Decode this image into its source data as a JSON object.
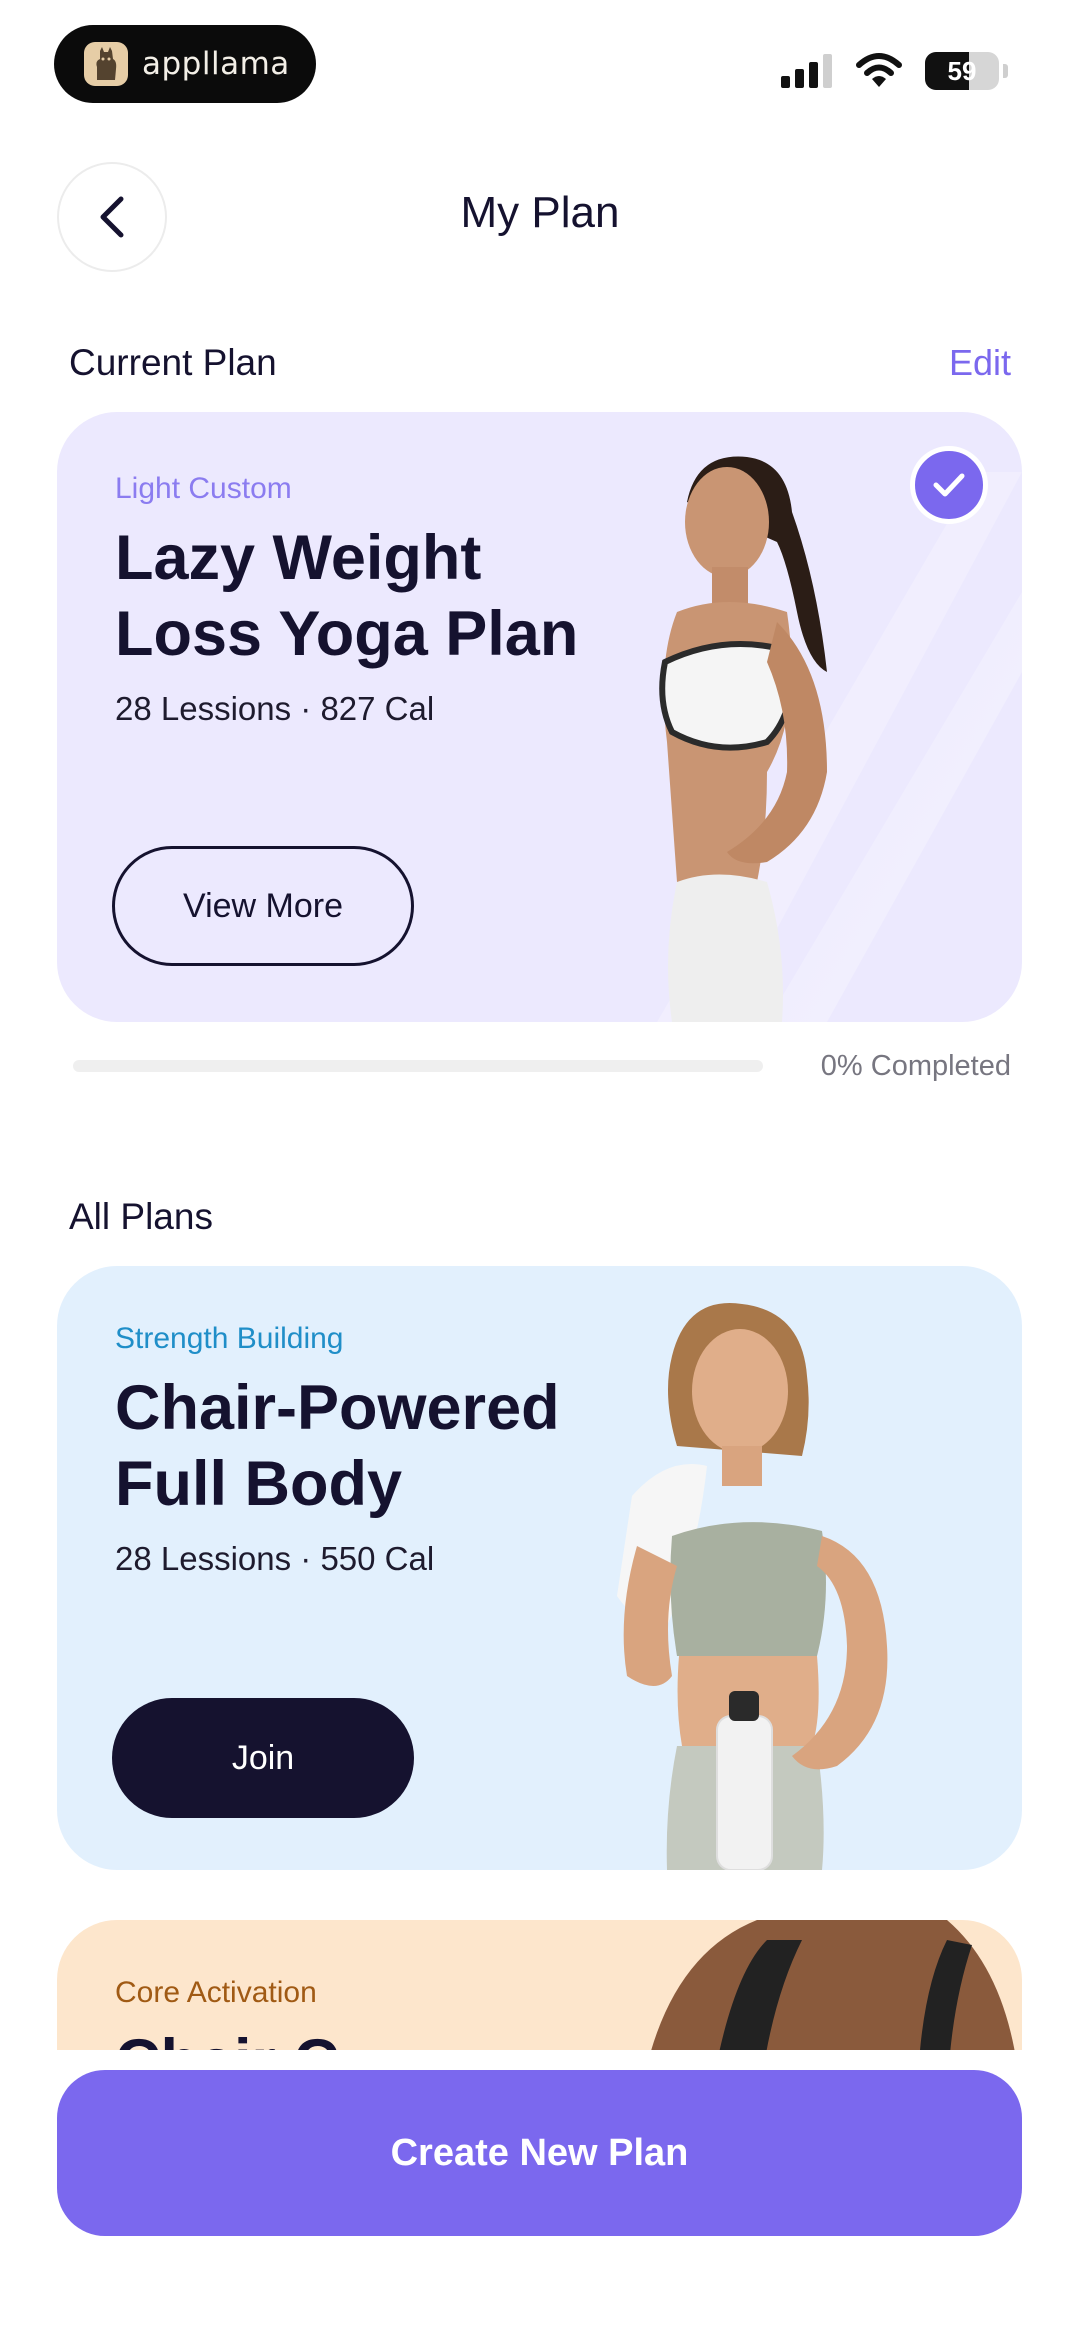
{
  "status_bar": {
    "brand": "appllama",
    "battery": "59",
    "battery_level_percent": 59
  },
  "header": {
    "title": "My Plan",
    "back_icon": "chevron-left-icon"
  },
  "current_plan": {
    "section_title": "Current Plan",
    "edit_label": "Edit",
    "card": {
      "category": "Light Custom",
      "title": "Lazy Weight Loss Yoga Plan",
      "meta": "28 Lessions · 827 Cal",
      "button_label": "View More",
      "selected_icon": "check-icon",
      "bg_color": "#ece9fe",
      "category_color": "#8b7cf0"
    },
    "progress_percent": 0,
    "progress_label": "0% Completed"
  },
  "all_plans": {
    "section_title": "All Plans",
    "cards": [
      {
        "category": "Strength Building",
        "title": "Chair-Powered Full Body",
        "meta": "28 Lessions · 550 Cal",
        "button_label": "Join",
        "bg_color": "#e2f0fd",
        "category_color": "#1f8ec8"
      },
      {
        "category": "Core Activation",
        "title": "Chair C",
        "bg_color": "#fde6cc",
        "category_color": "#a05a14"
      }
    ]
  },
  "cta": {
    "label": "Create New Plan",
    "color": "#7b68ee"
  }
}
